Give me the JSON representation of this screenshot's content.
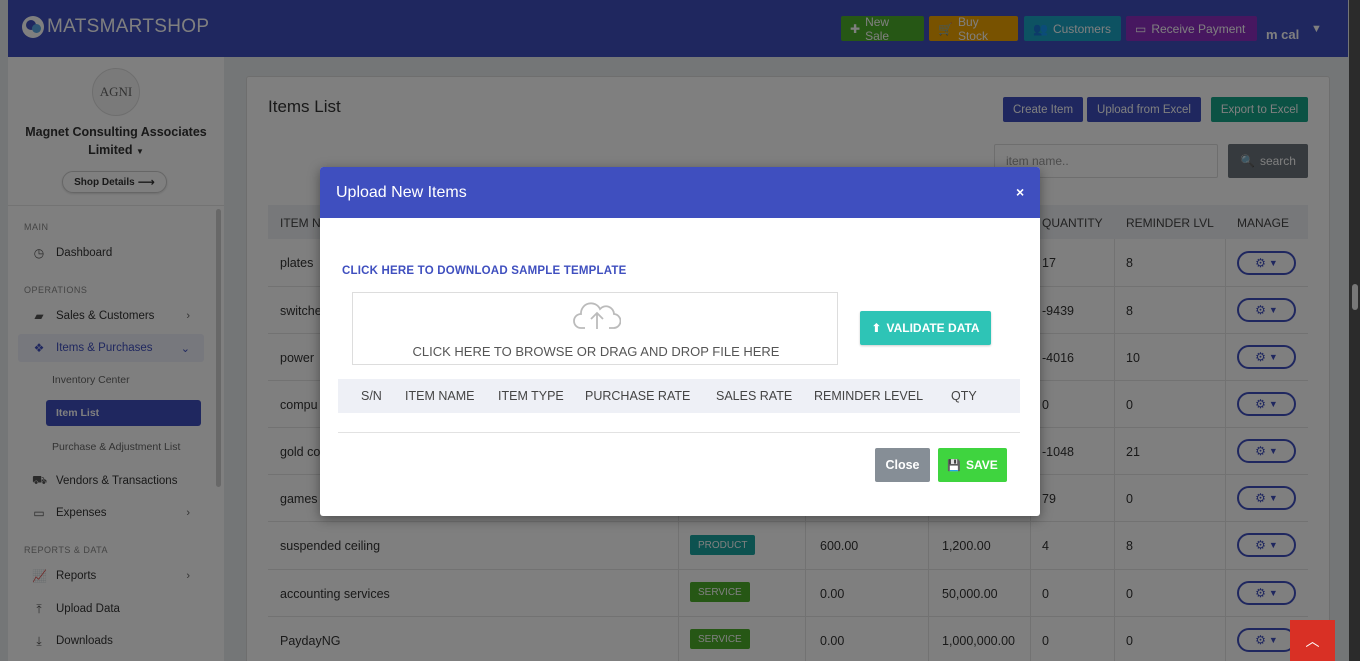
{
  "app": {
    "brand": "MATSMARTSHOP",
    "user": "m cal"
  },
  "topbar": {
    "new_sale": "New Sale",
    "buy_stock": "Buy Stock",
    "customers": "Customers",
    "receive_payment": "Receive Payment"
  },
  "sidebar": {
    "logo_text": "AGNI",
    "company_line1": "Magnet Consulting Associates",
    "company_line2": "Limited",
    "shop_details": "Shop Details",
    "section_main": "MAIN",
    "section_operations": "OPERATIONS",
    "section_reports": "REPORTS & DATA",
    "items": {
      "dashboard": "Dashboard",
      "sales_customers": "Sales & Customers",
      "items_purchases": "Items & Purchases",
      "inventory_center": "Inventory Center",
      "item_list": "Item List",
      "purchase_adjustment": "Purchase & Adjustment List",
      "vendors_transactions": "Vendors & Transactions",
      "expenses": "Expenses",
      "reports": "Reports",
      "upload_data": "Upload Data",
      "downloads": "Downloads"
    }
  },
  "main": {
    "title": "Items List",
    "create_item": "Create Item",
    "upload_excel": "Upload from Excel",
    "export_excel": "Export to Excel",
    "search_placeholder": "item name..",
    "search_button": "search",
    "table": {
      "headers": {
        "item_name": "ITEM N",
        "quantity": "QUANTITY",
        "reminder": "REMINDER LVL",
        "manage": "MANAGE"
      },
      "rows": [
        {
          "name": "plates",
          "qty": "17",
          "reminder": "8"
        },
        {
          "name": "switche",
          "qty": "-9439",
          "reminder": "8"
        },
        {
          "name": "power",
          "qty": "-4016",
          "reminder": "10"
        },
        {
          "name": "compu",
          "qty": "0",
          "reminder": "0"
        },
        {
          "name": "gold co",
          "qty": "-1048",
          "reminder": "21"
        },
        {
          "name": "games",
          "qty": "79",
          "reminder": "0"
        },
        {
          "name": "suspended ceiling",
          "type": "PRODUCT",
          "purchase": "600.00",
          "sales": "1,200.00",
          "qty": "4",
          "reminder": "8"
        },
        {
          "name": "accounting services",
          "type": "SERVICE",
          "purchase": "0.00",
          "sales": "50,000.00",
          "qty": "0",
          "reminder": "0"
        },
        {
          "name": "PaydayNG",
          "type": "SERVICE",
          "purchase": "0.00",
          "sales": "1,000,000.00",
          "qty": "0",
          "reminder": "0"
        }
      ]
    }
  },
  "modal": {
    "title": "Upload New Items",
    "close_x": "×",
    "download_link": "CLICK HERE TO DOWNLOAD SAMPLE TEMPLATE",
    "drop_text": "CLICK HERE TO BROWSE OR DRAG AND DROP FILE HERE",
    "validate": "VALIDATE DATA",
    "columns": [
      "S/N",
      "ITEM NAME",
      "ITEM TYPE",
      "PURCHASE RATE",
      "SALES RATE",
      "REMINDER LEVEL",
      "QTY"
    ],
    "close_button": "Close",
    "save_button": "SAVE"
  },
  "icons": {
    "back_to_top": "chevron-up"
  },
  "colors": {
    "primary": "#3f4fbf",
    "success": "#4caf2a",
    "warning": "#f0a500",
    "info": "#1aa5c4",
    "purple": "#8e2fc0",
    "teal": "#2ec4b6",
    "danger": "#d93025"
  }
}
